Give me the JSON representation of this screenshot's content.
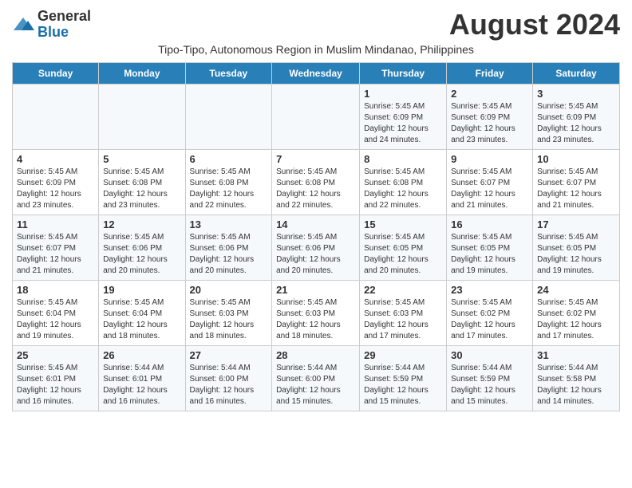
{
  "logo": {
    "line1": "General",
    "line2": "Blue"
  },
  "title": "August 2024",
  "subtitle": "Tipo-Tipo, Autonomous Region in Muslim Mindanao, Philippines",
  "headers": [
    "Sunday",
    "Monday",
    "Tuesday",
    "Wednesday",
    "Thursday",
    "Friday",
    "Saturday"
  ],
  "weeks": [
    [
      {
        "day": "",
        "info": ""
      },
      {
        "day": "",
        "info": ""
      },
      {
        "day": "",
        "info": ""
      },
      {
        "day": "",
        "info": ""
      },
      {
        "day": "1",
        "info": "Sunrise: 5:45 AM\nSunset: 6:09 PM\nDaylight: 12 hours and 24 minutes."
      },
      {
        "day": "2",
        "info": "Sunrise: 5:45 AM\nSunset: 6:09 PM\nDaylight: 12 hours and 23 minutes."
      },
      {
        "day": "3",
        "info": "Sunrise: 5:45 AM\nSunset: 6:09 PM\nDaylight: 12 hours and 23 minutes."
      }
    ],
    [
      {
        "day": "4",
        "info": "Sunrise: 5:45 AM\nSunset: 6:09 PM\nDaylight: 12 hours and 23 minutes."
      },
      {
        "day": "5",
        "info": "Sunrise: 5:45 AM\nSunset: 6:08 PM\nDaylight: 12 hours and 23 minutes."
      },
      {
        "day": "6",
        "info": "Sunrise: 5:45 AM\nSunset: 6:08 PM\nDaylight: 12 hours and 22 minutes."
      },
      {
        "day": "7",
        "info": "Sunrise: 5:45 AM\nSunset: 6:08 PM\nDaylight: 12 hours and 22 minutes."
      },
      {
        "day": "8",
        "info": "Sunrise: 5:45 AM\nSunset: 6:08 PM\nDaylight: 12 hours and 22 minutes."
      },
      {
        "day": "9",
        "info": "Sunrise: 5:45 AM\nSunset: 6:07 PM\nDaylight: 12 hours and 21 minutes."
      },
      {
        "day": "10",
        "info": "Sunrise: 5:45 AM\nSunset: 6:07 PM\nDaylight: 12 hours and 21 minutes."
      }
    ],
    [
      {
        "day": "11",
        "info": "Sunrise: 5:45 AM\nSunset: 6:07 PM\nDaylight: 12 hours and 21 minutes."
      },
      {
        "day": "12",
        "info": "Sunrise: 5:45 AM\nSunset: 6:06 PM\nDaylight: 12 hours and 20 minutes."
      },
      {
        "day": "13",
        "info": "Sunrise: 5:45 AM\nSunset: 6:06 PM\nDaylight: 12 hours and 20 minutes."
      },
      {
        "day": "14",
        "info": "Sunrise: 5:45 AM\nSunset: 6:06 PM\nDaylight: 12 hours and 20 minutes."
      },
      {
        "day": "15",
        "info": "Sunrise: 5:45 AM\nSunset: 6:05 PM\nDaylight: 12 hours and 20 minutes."
      },
      {
        "day": "16",
        "info": "Sunrise: 5:45 AM\nSunset: 6:05 PM\nDaylight: 12 hours and 19 minutes."
      },
      {
        "day": "17",
        "info": "Sunrise: 5:45 AM\nSunset: 6:05 PM\nDaylight: 12 hours and 19 minutes."
      }
    ],
    [
      {
        "day": "18",
        "info": "Sunrise: 5:45 AM\nSunset: 6:04 PM\nDaylight: 12 hours and 19 minutes."
      },
      {
        "day": "19",
        "info": "Sunrise: 5:45 AM\nSunset: 6:04 PM\nDaylight: 12 hours and 18 minutes."
      },
      {
        "day": "20",
        "info": "Sunrise: 5:45 AM\nSunset: 6:03 PM\nDaylight: 12 hours and 18 minutes."
      },
      {
        "day": "21",
        "info": "Sunrise: 5:45 AM\nSunset: 6:03 PM\nDaylight: 12 hours and 18 minutes."
      },
      {
        "day": "22",
        "info": "Sunrise: 5:45 AM\nSunset: 6:03 PM\nDaylight: 12 hours and 17 minutes."
      },
      {
        "day": "23",
        "info": "Sunrise: 5:45 AM\nSunset: 6:02 PM\nDaylight: 12 hours and 17 minutes."
      },
      {
        "day": "24",
        "info": "Sunrise: 5:45 AM\nSunset: 6:02 PM\nDaylight: 12 hours and 17 minutes."
      }
    ],
    [
      {
        "day": "25",
        "info": "Sunrise: 5:45 AM\nSunset: 6:01 PM\nDaylight: 12 hours and 16 minutes."
      },
      {
        "day": "26",
        "info": "Sunrise: 5:44 AM\nSunset: 6:01 PM\nDaylight: 12 hours and 16 minutes."
      },
      {
        "day": "27",
        "info": "Sunrise: 5:44 AM\nSunset: 6:00 PM\nDaylight: 12 hours and 16 minutes."
      },
      {
        "day": "28",
        "info": "Sunrise: 5:44 AM\nSunset: 6:00 PM\nDaylight: 12 hours and 15 minutes."
      },
      {
        "day": "29",
        "info": "Sunrise: 5:44 AM\nSunset: 5:59 PM\nDaylight: 12 hours and 15 minutes."
      },
      {
        "day": "30",
        "info": "Sunrise: 5:44 AM\nSunset: 5:59 PM\nDaylight: 12 hours and 15 minutes."
      },
      {
        "day": "31",
        "info": "Sunrise: 5:44 AM\nSunset: 5:58 PM\nDaylight: 12 hours and 14 minutes."
      }
    ]
  ]
}
